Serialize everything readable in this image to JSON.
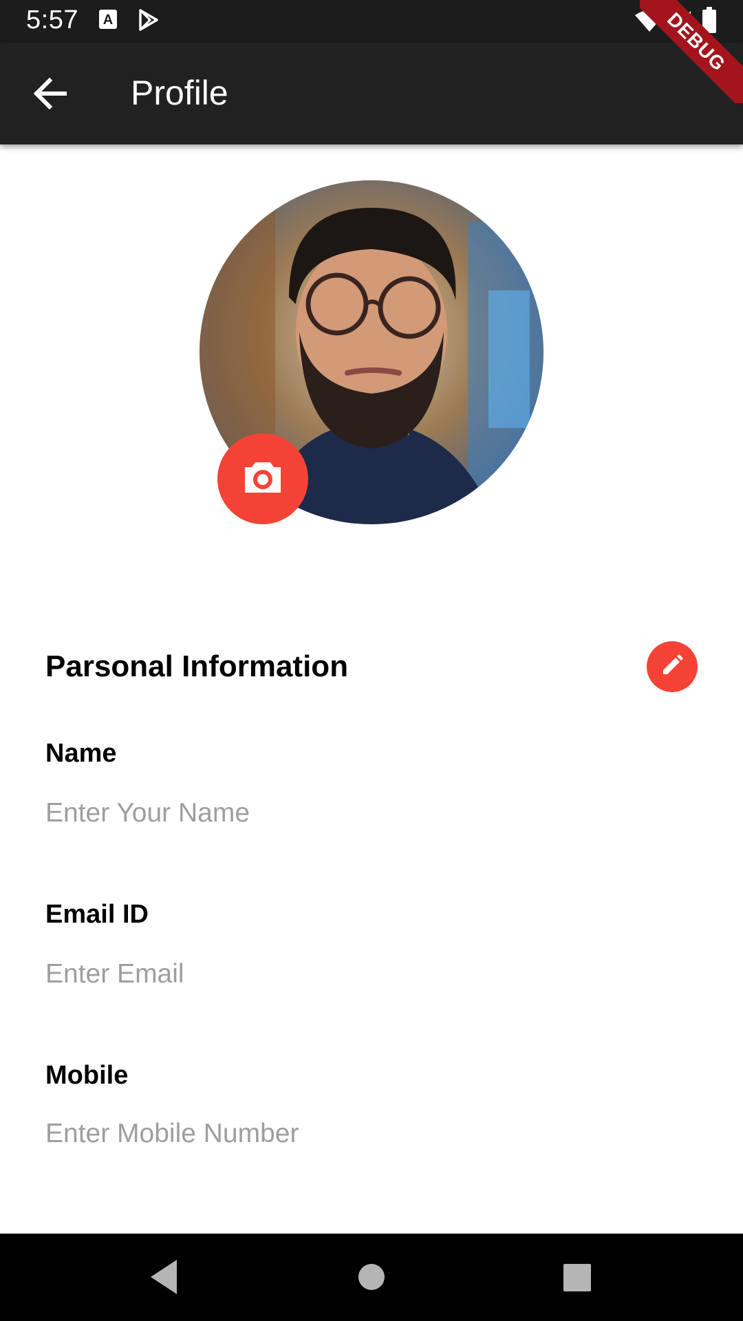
{
  "status_bar": {
    "time": "5:57",
    "icons": [
      "a-icon",
      "play-store-icon",
      "wifi-icon",
      "signal-icon",
      "battery-icon"
    ]
  },
  "debug_ribbon": {
    "label": "DEBUG"
  },
  "app_bar": {
    "title": "Profile",
    "back_icon": "arrow-back-icon"
  },
  "profile": {
    "camera_icon": "camera-icon"
  },
  "section": {
    "title": "Parsonal Information",
    "edit_icon": "pencil-icon"
  },
  "fields": {
    "name": {
      "label": "Name",
      "placeholder": "Enter Your Name",
      "value": ""
    },
    "email": {
      "label": "Email ID",
      "placeholder": "Enter Email",
      "value": ""
    },
    "mobile": {
      "label": "Mobile",
      "placeholder": "Enter Mobile Number",
      "value": ""
    }
  },
  "nav_bar": {
    "icons": [
      "nav-back-icon",
      "nav-home-icon",
      "nav-recents-icon"
    ]
  },
  "colors": {
    "accent": "#f44336",
    "app_bar": "#212121",
    "status_bar": "#1c1c1c",
    "ribbon": "#a3141c",
    "placeholder": "#9e9e9e"
  }
}
